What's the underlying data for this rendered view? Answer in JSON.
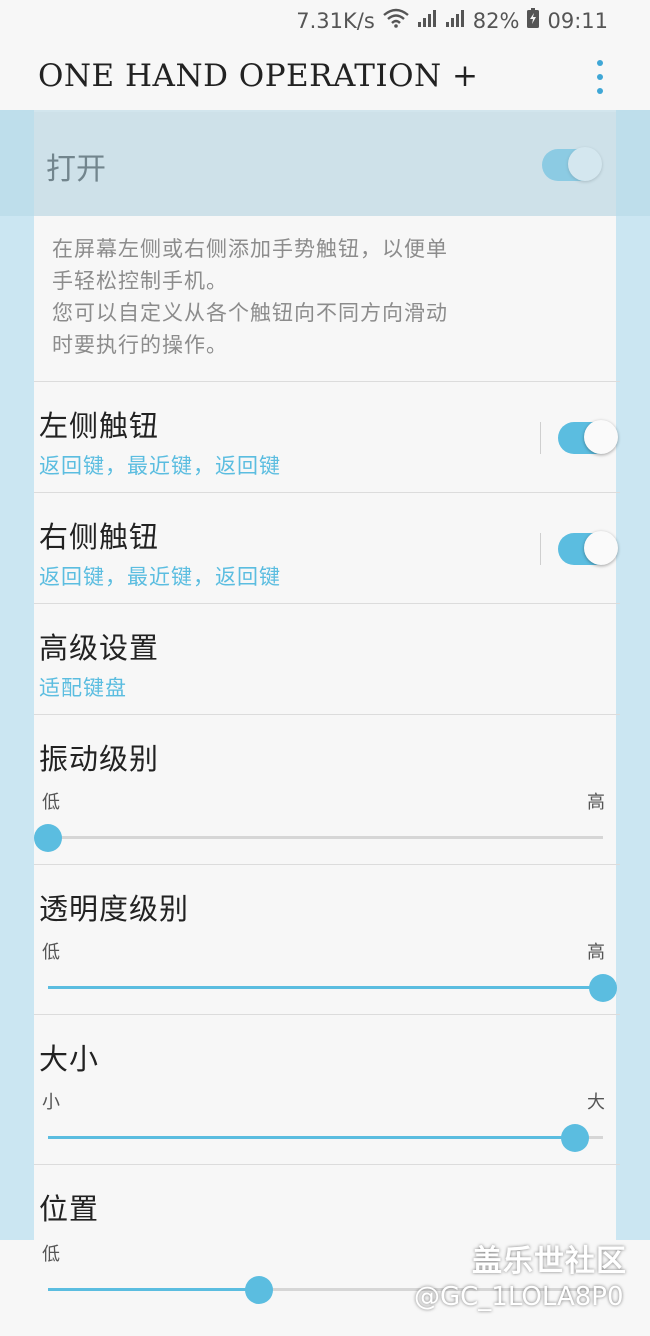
{
  "status": {
    "speed": "7.31K/s",
    "battery": "82%",
    "time": "09:11",
    "icons": [
      "wifi-icon",
      "signal-icon",
      "4g-signal-icon",
      "battery-charging-icon"
    ]
  },
  "appbar": {
    "title": "ONE HAND OPERATION +",
    "menu_icon": "more-vert-icon"
  },
  "master": {
    "label": "打开",
    "on": true
  },
  "description": {
    "line1": "在屏幕左侧或右侧添加手势触钮，以便单",
    "line2": "手轻松控制手机。",
    "line3": "您可以自定义从各个触钮向不同方向滑动",
    "line4": "时要执行的操作。"
  },
  "left_handle": {
    "title": "左侧触钮",
    "subtitle": "返回键，最近键，返回键",
    "on": true
  },
  "right_handle": {
    "title": "右侧触钮",
    "subtitle": "返回键，最近键，返回键",
    "on": true
  },
  "advanced": {
    "title": "高级设置",
    "subtitle": "适配键盘"
  },
  "vibration": {
    "title": "振动级别",
    "min_label": "低",
    "max_label": "高",
    "level": 0.0
  },
  "transparency": {
    "title": "透明度级别",
    "min_label": "低",
    "max_label": "高",
    "level": 1.0
  },
  "size": {
    "title": "大小",
    "min_label": "小",
    "max_label": "大",
    "level": 0.95
  },
  "position": {
    "title": "位置",
    "min_label": "低",
    "level": 0.38
  },
  "watermark": {
    "line1": "盖乐世社区",
    "line2": "@GC_1LOLA8P0"
  },
  "colors": {
    "accent": "#5bbde0",
    "handle_strip": "#cbe6f2"
  }
}
